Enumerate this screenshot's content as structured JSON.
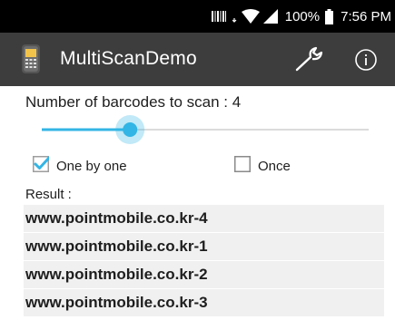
{
  "status_bar": {
    "battery": "100%",
    "time": "7:56 PM"
  },
  "app_bar": {
    "title": "MultiScanDemo",
    "icons": [
      "scanner-app-icon",
      "wrench-icon",
      "info-icon"
    ],
    "color": "#3d3d3d"
  },
  "settings": {
    "count_label": "Number of barcodes to scan : 4",
    "slider": {
      "value": 4,
      "fraction": 0.27,
      "accent": "#33b5e5"
    },
    "one_by_one": {
      "label": "One by one",
      "checked": true
    },
    "once": {
      "label": "Once",
      "checked": false
    }
  },
  "result": {
    "label": "Result :",
    "items": [
      "www.pointmobile.co.kr-4",
      "www.pointmobile.co.kr-1",
      "www.pointmobile.co.kr-2",
      "www.pointmobile.co.kr-3"
    ]
  }
}
